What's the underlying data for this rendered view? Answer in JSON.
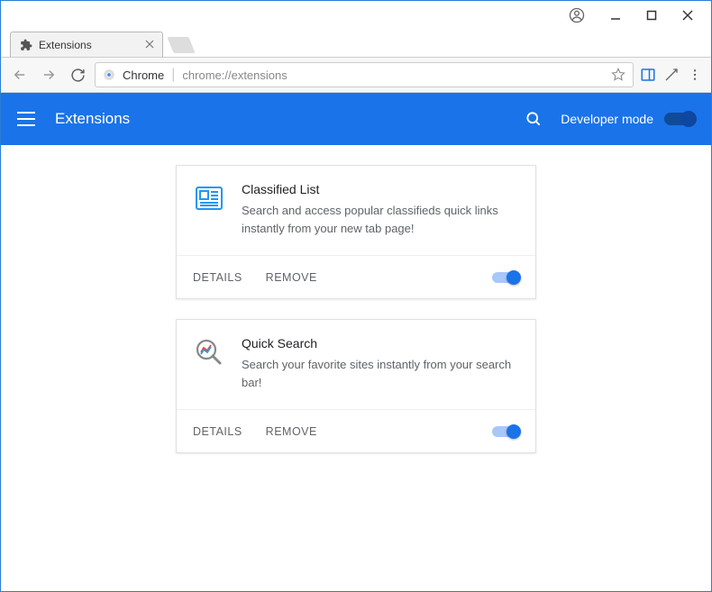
{
  "window": {
    "tab_title": "Extensions"
  },
  "toolbar": {
    "app_label": "Chrome",
    "url": "chrome://extensions"
  },
  "appbar": {
    "title": "Extensions",
    "dev_mode_label": "Developer mode",
    "dev_mode_on": true
  },
  "labels": {
    "details": "DETAILS",
    "remove": "REMOVE"
  },
  "extensions": [
    {
      "name": "Classified List",
      "description": "Search and access popular classifieds quick links instantly from your new tab page!",
      "icon": "newspaper",
      "enabled": true
    },
    {
      "name": "Quick Search",
      "description": "Search your favorite sites instantly from your search bar!",
      "icon": "magnifier-chart",
      "enabled": true
    }
  ]
}
